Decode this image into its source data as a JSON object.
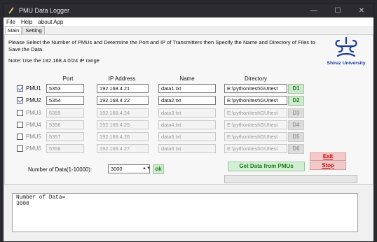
{
  "window": {
    "title": "PMU Data Logger",
    "min": "—",
    "max": "☐",
    "close": "✕"
  },
  "menu": [
    "File",
    "Help",
    "about App"
  ],
  "tabs": [
    "Main",
    "Setting"
  ],
  "instructions": "Please Select the Number of PMUs and Determine the Port and IP of Transmitters then Specify the Name and Directory of Files to Save the Data.",
  "note": "Note: Use the 192.168.4.0/24 IP range",
  "logo_text": "Shiraz University",
  "columns": {
    "port": "Port",
    "ip": "IP Address",
    "name": "Name",
    "directory": "Directory"
  },
  "pmus": [
    {
      "label": "PMU1",
      "checked": true,
      "port": "5353",
      "ip": "192.168.4.21",
      "name": "data1.txt",
      "dir": "E:\\python\\test\\GUItest",
      "btn": "D1",
      "enabled": true
    },
    {
      "label": "PMU2",
      "checked": true,
      "port": "5354",
      "ip": "192.168.4.22",
      "name": "data2.txt",
      "dir": "E:\\python\\test\\GUItest",
      "btn": "D2",
      "enabled": true
    },
    {
      "label": "PMU3",
      "checked": false,
      "port": "5355",
      "ip": "192.168.4.24",
      "name": "data3.txt",
      "dir": "E:\\python\\test\\GUItest",
      "btn": "D3",
      "enabled": false
    },
    {
      "label": "PMU4",
      "checked": false,
      "port": "5356",
      "ip": "192.168.4.25",
      "name": "data4.txt",
      "dir": "E:\\python\\test\\GUItest",
      "btn": "D4",
      "enabled": false
    },
    {
      "label": "PMU5",
      "checked": false,
      "port": "5357",
      "ip": "192.168.4.26",
      "name": "data5.txt",
      "dir": "E:\\python\\test\\GUItest",
      "btn": "D5",
      "enabled": false
    },
    {
      "label": "PMU6",
      "checked": false,
      "port": "5358",
      "ip": "192.168.4.27",
      "name": "data6.txt",
      "dir": "E:\\python\\test\\GUItest",
      "btn": "D6",
      "enabled": false
    }
  ],
  "buttons": {
    "exit": "Exit",
    "stop": "Stop",
    "get_data": "Get Data from PMUs",
    "ok": "ok"
  },
  "num_data": {
    "label": "Number of Data(1-10000):",
    "value": "3000"
  },
  "output": "Number of Data=\n3000"
}
